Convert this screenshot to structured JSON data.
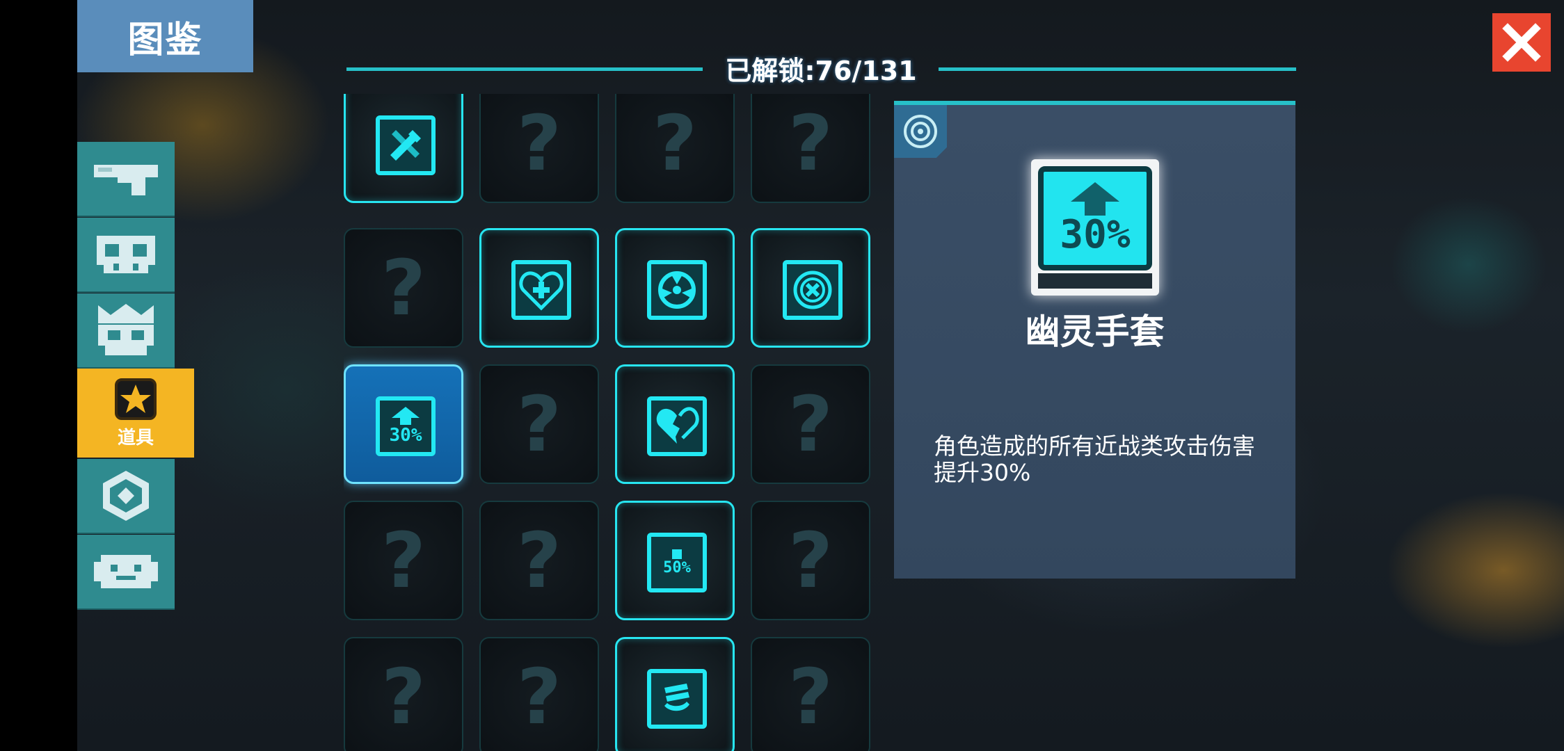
{
  "title": "图鉴",
  "close_icon": "close-icon",
  "header": {
    "unlock_label": "已解锁:76/131"
  },
  "sidebar": {
    "items": [
      {
        "icon": "gun-icon",
        "label": ""
      },
      {
        "icon": "skull-icon",
        "label": ""
      },
      {
        "icon": "crowned-skull-icon",
        "label": ""
      },
      {
        "icon": "star-icon",
        "label": "道具",
        "active": true
      },
      {
        "icon": "hexagon-badge-icon",
        "label": ""
      },
      {
        "icon": "robot-face-icon",
        "label": ""
      }
    ]
  },
  "grid": {
    "rows": [
      [
        "weapons-icon",
        "?",
        "?",
        "?"
      ],
      [
        "?",
        "heart-cross-icon",
        "radiation-icon",
        "cross-circle-icon"
      ],
      [
        "arrow-up-30-icon",
        "?",
        "broken-heart-icon",
        "?"
      ],
      [
        "?",
        "?",
        "bottle-50-icon",
        "?"
      ],
      [
        "?",
        "?",
        "coins-icon",
        "?"
      ]
    ],
    "unlocked_labels": {
      "arrow-up-30-icon": "30%",
      "bottle-50-icon": "50%"
    },
    "selected": "arrow-up-30-icon"
  },
  "detail": {
    "tag_icon": "target-icon",
    "icon_label": "30%",
    "name": "幽灵手套",
    "description": "角色造成的所有近战类攻击伤害提升30%"
  },
  "colors": {
    "accent": "#27e5f0",
    "title_tab": "#5a8dbb",
    "close": "#e8452f",
    "sidebar": "#2f8b8f",
    "active_tab": "#f4b523",
    "selected_slot": "#1571b8",
    "panel": "#3a4e66"
  }
}
